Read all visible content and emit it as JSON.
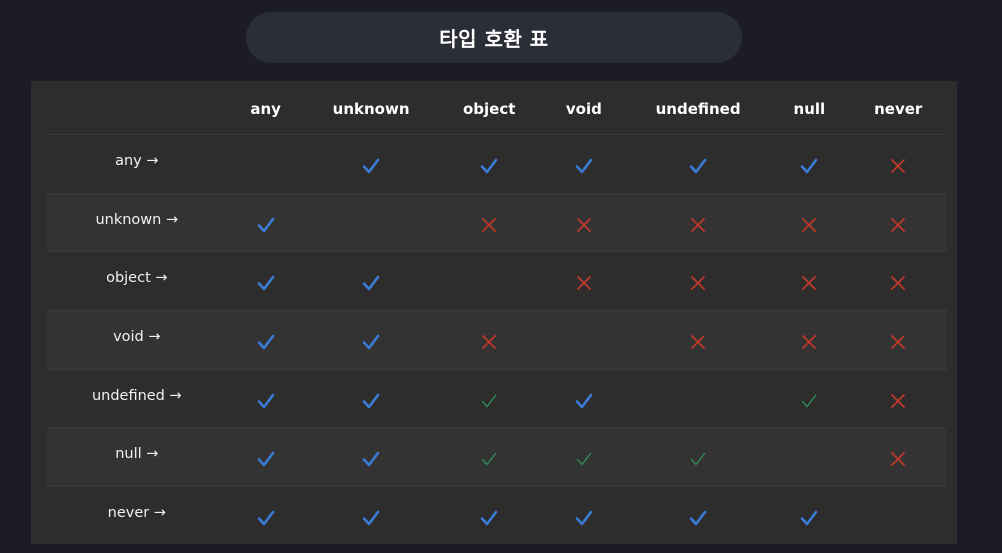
{
  "title": "타입 호환 표",
  "columns": [
    "any",
    "unknown",
    "object",
    "void",
    "undefined",
    "null",
    "never"
  ],
  "rows": [
    {
      "label": "any →",
      "cells": [
        "",
        "check",
        "check",
        "check",
        "check",
        "check",
        "cross"
      ]
    },
    {
      "label": "unknown →",
      "cells": [
        "check",
        "",
        "cross",
        "cross",
        "cross",
        "cross",
        "cross"
      ]
    },
    {
      "label": "object →",
      "cells": [
        "check",
        "check",
        "",
        "cross",
        "cross",
        "cross",
        "cross"
      ]
    },
    {
      "label": "void →",
      "cells": [
        "check",
        "check",
        "cross",
        "",
        "cross",
        "cross",
        "cross"
      ]
    },
    {
      "label": "undefined →",
      "cells": [
        "check",
        "check",
        "check-green",
        "check",
        "",
        "check-green",
        "cross"
      ]
    },
    {
      "label": "null →",
      "cells": [
        "check",
        "check",
        "check-green",
        "check-green",
        "check-green",
        "",
        "cross"
      ]
    },
    {
      "label": "never →",
      "cells": [
        "check",
        "check",
        "check",
        "check",
        "check",
        "check",
        ""
      ]
    }
  ],
  "legend_icons": {
    "check": "check-icon",
    "check-green": "thin-check-icon",
    "cross": "cross-icon"
  },
  "colors": {
    "check": "#3a7bd5",
    "check-green": "#2e8b57",
    "cross": "#c0392b",
    "panel": "#2d2d2d",
    "background": "#1b1c27"
  }
}
